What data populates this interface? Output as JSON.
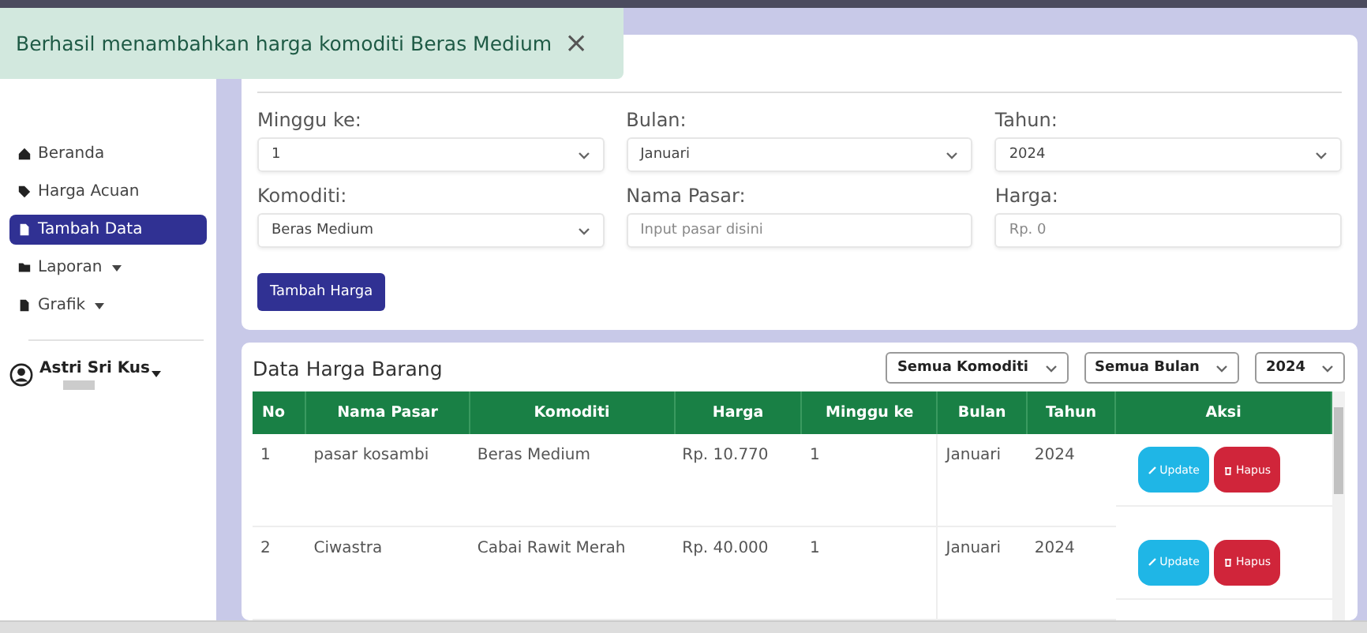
{
  "toast": {
    "message": "Berhasil menambahkan harga komoditi Beras Medium",
    "close": "×"
  },
  "sidebar": {
    "items": [
      {
        "label": "Beranda",
        "selected": false,
        "dropdown": false
      },
      {
        "label": "Harga Acuan",
        "selected": false,
        "dropdown": false
      },
      {
        "label": "Tambah Data",
        "selected": true,
        "dropdown": false
      },
      {
        "label": "Laporan",
        "selected": false,
        "dropdown": true
      },
      {
        "label": "Grafik",
        "selected": false,
        "dropdown": true
      }
    ],
    "user": {
      "name": "Astri Sri Kus"
    }
  },
  "form": {
    "fields": [
      {
        "label": "Minggu ke:",
        "kind": "select",
        "value": "1"
      },
      {
        "label": "Bulan:",
        "kind": "select",
        "value": "Januari"
      },
      {
        "label": "Tahun:",
        "kind": "select",
        "value": "2024"
      },
      {
        "label": "Komoditi:",
        "kind": "select",
        "value": "Beras Medium"
      },
      {
        "label": "Nama Pasar:",
        "kind": "input",
        "placeholder": "Input pasar disini"
      },
      {
        "label": "Harga:",
        "kind": "input",
        "placeholder": "Rp. 0"
      }
    ],
    "submit": "Tambah Harga"
  },
  "table": {
    "title": "Data Harga Barang",
    "filters": [
      "Semua Komoditi",
      "Semua Bulan",
      "2024"
    ],
    "columns": [
      "No",
      "Nama Pasar",
      "Komoditi",
      "Harga",
      "Minggu ke",
      "Bulan",
      "Tahun",
      "Aksi"
    ],
    "rows": [
      {
        "cells": [
          "1",
          "pasar kosambi",
          "Beras Medium",
          "Rp. 10.770",
          "1",
          "Januari",
          "2024"
        ],
        "actions": [
          "Update",
          "Hapus"
        ]
      },
      {
        "cells": [
          "2",
          "Ciwastra",
          "Cabai Rawit Merah",
          "Rp. 40.000",
          "1",
          "Januari",
          "2024"
        ],
        "actions": [
          "Update",
          "Hapus"
        ]
      }
    ]
  }
}
